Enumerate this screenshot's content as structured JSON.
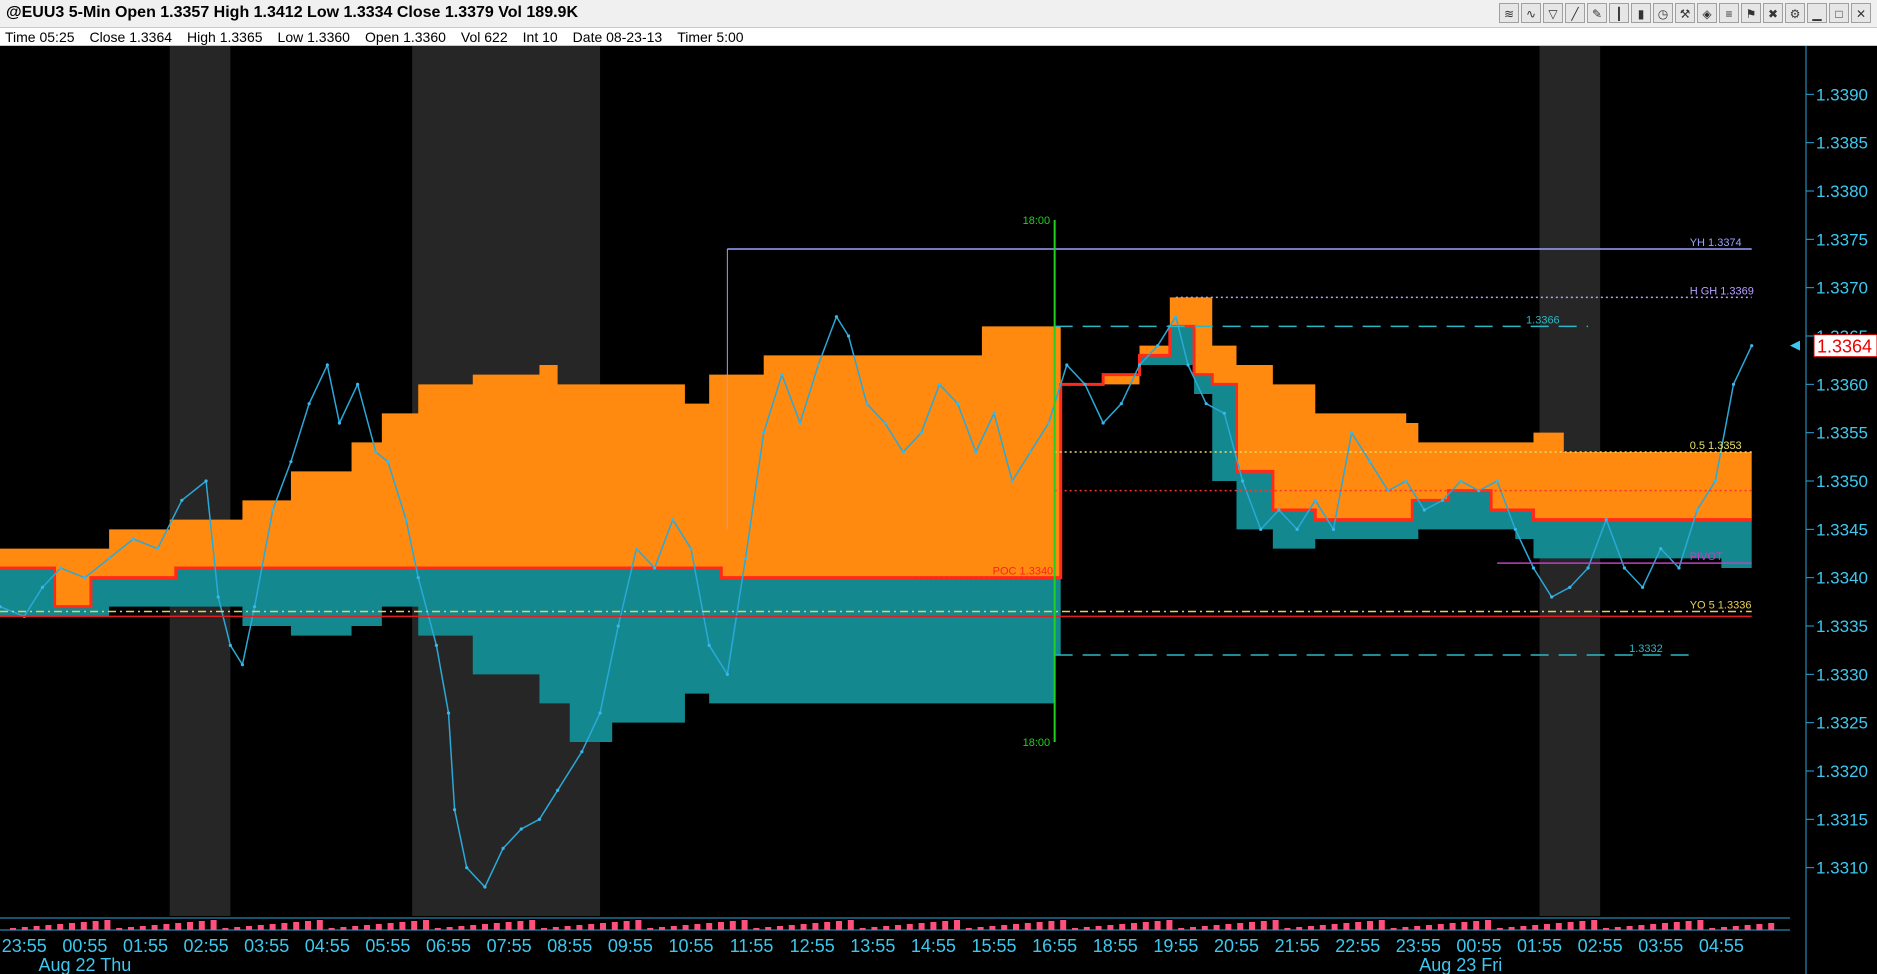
{
  "title": "@EUU3 5-Min Open 1.3357 High 1.3412 Low 1.3334 Close 1.3379 Vol 189.9K",
  "toolbar": {
    "buttons": [
      {
        "name": "chart-type-icon",
        "glyph": "≋"
      },
      {
        "name": "indicator-icon",
        "glyph": "∿"
      },
      {
        "name": "filter-icon",
        "glyph": "▽"
      },
      {
        "name": "draw-line-icon",
        "glyph": "╱"
      },
      {
        "name": "pencil-icon",
        "glyph": "✎"
      },
      {
        "name": "bar-style-icon",
        "glyph": "┃"
      },
      {
        "name": "candle-icon",
        "glyph": "▮"
      },
      {
        "name": "clock-icon",
        "glyph": "◷"
      },
      {
        "name": "tools-icon",
        "glyph": "⚒"
      },
      {
        "name": "alert-icon",
        "glyph": "◈"
      },
      {
        "name": "fib-icon",
        "glyph": "≡"
      },
      {
        "name": "flag-icon",
        "glyph": "⚑"
      },
      {
        "name": "trash-icon",
        "glyph": "✖"
      },
      {
        "name": "settings-icon",
        "glyph": "⚙"
      },
      {
        "name": "minimize-icon",
        "glyph": "▁"
      },
      {
        "name": "maximize-icon",
        "glyph": "□"
      },
      {
        "name": "close-icon",
        "glyph": "✕"
      }
    ]
  },
  "info": {
    "time": "Time 05:25",
    "close": "Close 1.3364",
    "high": "High 1.3365",
    "low": "Low 1.3360",
    "open": "Open 1.3360",
    "vol": "Vol 622",
    "int": "Int 10",
    "date": "Date 08-23-13",
    "timer": "Timer 5:00"
  },
  "chart_data": {
    "type": "line",
    "ylim": [
      1.3305,
      1.3395
    ],
    "y_ticks": [
      "1.3390",
      "1.3385",
      "1.3380",
      "1.3375",
      "1.3370",
      "1.3365",
      "1.3360",
      "1.3355",
      "1.3350",
      "1.3345",
      "1.3340",
      "1.3335",
      "1.3330",
      "1.3325",
      "1.3320",
      "1.3315",
      "1.3310"
    ],
    "x_ticks": [
      "23:55",
      "00:55",
      "01:55",
      "02:55",
      "03:55",
      "04:55",
      "05:55",
      "06:55",
      "07:55",
      "08:55",
      "09:55",
      "10:55",
      "11:55",
      "12:55",
      "13:55",
      "14:55",
      "15:55",
      "16:55",
      "18:55",
      "19:55",
      "20:55",
      "21:55",
      "22:55",
      "23:55",
      "00:55",
      "01:55",
      "02:55",
      "03:55",
      "04:55"
    ],
    "date_labels": [
      {
        "text": "Aug 22 Thu",
        "at": 1
      },
      {
        "text": "Aug 23 Fri",
        "at": 23.7
      }
    ],
    "shaded_sessions": [
      [
        2.4,
        3.4
      ],
      [
        6.4,
        9.5
      ],
      [
        25.0,
        26.0
      ]
    ],
    "x_range": [
      -0.4,
      29.0
    ],
    "value_area_top": [
      [
        -0.4,
        1.3343
      ],
      [
        1.4,
        1.3345
      ],
      [
        2.4,
        1.3346
      ],
      [
        3.6,
        1.3348
      ],
      [
        4.4,
        1.3351
      ],
      [
        5.4,
        1.3354
      ],
      [
        5.9,
        1.3357
      ],
      [
        6.5,
        1.336
      ],
      [
        7.4,
        1.3361
      ],
      [
        8.5,
        1.3362
      ],
      [
        8.8,
        1.336
      ],
      [
        10.9,
        1.3358
      ],
      [
        11.3,
        1.3361
      ],
      [
        12.2,
        1.3363
      ],
      [
        15.3,
        1.3363
      ],
      [
        15.8,
        1.3366
      ],
      [
        17.0,
        1.3366
      ],
      [
        17.1,
        1.336
      ],
      [
        17.8,
        1.336
      ],
      [
        18.4,
        1.3364
      ],
      [
        18.9,
        1.3369
      ],
      [
        19.3,
        1.3369
      ],
      [
        19.6,
        1.3364
      ],
      [
        20.0,
        1.3362
      ],
      [
        20.6,
        1.336
      ],
      [
        21.3,
        1.3357
      ],
      [
        22.8,
        1.3356
      ],
      [
        23.0,
        1.3354
      ],
      [
        24.6,
        1.3354
      ],
      [
        24.9,
        1.3355
      ],
      [
        25.4,
        1.3353
      ],
      [
        28.0,
        1.3353
      ],
      [
        28.5,
        1.3356
      ]
    ],
    "value_area_bottom": [
      [
        -0.4,
        1.3336
      ],
      [
        1.4,
        1.3337
      ],
      [
        2.4,
        1.3337
      ],
      [
        3.6,
        1.3335
      ],
      [
        4.4,
        1.3334
      ],
      [
        5.4,
        1.3335
      ],
      [
        5.9,
        1.3337
      ],
      [
        6.5,
        1.3334
      ],
      [
        7.4,
        1.333
      ],
      [
        8.5,
        1.3327
      ],
      [
        9.0,
        1.3323
      ],
      [
        9.7,
        1.3325
      ],
      [
        10.9,
        1.3328
      ],
      [
        11.3,
        1.3327
      ],
      [
        13.5,
        1.3327
      ],
      [
        15.3,
        1.3327
      ],
      [
        15.8,
        1.3327
      ],
      [
        17.0,
        1.3332
      ],
      [
        17.1,
        1.336
      ],
      [
        17.8,
        1.3361
      ],
      [
        18.4,
        1.3362
      ],
      [
        18.9,
        1.3362
      ],
      [
        19.3,
        1.3359
      ],
      [
        19.6,
        1.335
      ],
      [
        20.0,
        1.3345
      ],
      [
        20.6,
        1.3343
      ],
      [
        21.3,
        1.3344
      ],
      [
        22.8,
        1.3344
      ],
      [
        23.0,
        1.3345
      ],
      [
        24.6,
        1.3344
      ],
      [
        24.9,
        1.3342
      ],
      [
        25.4,
        1.3342
      ],
      [
        28.0,
        1.3341
      ],
      [
        28.5,
        1.3339
      ]
    ],
    "poc_line": [
      [
        -0.4,
        1.3341
      ],
      [
        0.3,
        1.3341
      ],
      [
        0.5,
        1.3337
      ],
      [
        1.0,
        1.3337
      ],
      [
        1.1,
        1.334
      ],
      [
        2.4,
        1.334
      ],
      [
        2.5,
        1.3341
      ],
      [
        11.3,
        1.3341
      ],
      [
        11.5,
        1.334
      ],
      [
        17.0,
        1.334
      ],
      [
        17.1,
        1.336
      ],
      [
        17.8,
        1.3361
      ],
      [
        18.4,
        1.3363
      ],
      [
        18.9,
        1.3366
      ],
      [
        19.3,
        1.3361
      ],
      [
        19.6,
        1.336
      ],
      [
        20.0,
        1.3351
      ],
      [
        20.6,
        1.3347
      ],
      [
        21.3,
        1.3346
      ],
      [
        22.8,
        1.3346
      ],
      [
        22.9,
        1.3348
      ],
      [
        23.5,
        1.3349
      ],
      [
        24.0,
        1.3349
      ],
      [
        24.2,
        1.3347
      ],
      [
        24.6,
        1.3347
      ],
      [
        24.9,
        1.3346
      ],
      [
        28.5,
        1.3346
      ]
    ],
    "price": [
      [
        -0.4,
        1.3337
      ],
      [
        0.0,
        1.3336
      ],
      [
        0.3,
        1.3339
      ],
      [
        0.6,
        1.3341
      ],
      [
        1.0,
        1.334
      ],
      [
        1.4,
        1.3342
      ],
      [
        1.8,
        1.3344
      ],
      [
        2.2,
        1.3343
      ],
      [
        2.6,
        1.3348
      ],
      [
        3.0,
        1.335
      ],
      [
        3.2,
        1.3338
      ],
      [
        3.4,
        1.3333
      ],
      [
        3.6,
        1.3331
      ],
      [
        3.8,
        1.3337
      ],
      [
        4.1,
        1.3347
      ],
      [
        4.4,
        1.3352
      ],
      [
        4.7,
        1.3358
      ],
      [
        5.0,
        1.3362
      ],
      [
        5.2,
        1.3356
      ],
      [
        5.5,
        1.336
      ],
      [
        5.8,
        1.3353
      ],
      [
        6.0,
        1.3352
      ],
      [
        6.3,
        1.3346
      ],
      [
        6.5,
        1.334
      ],
      [
        6.8,
        1.3333
      ],
      [
        7.0,
        1.3326
      ],
      [
        7.1,
        1.3316
      ],
      [
        7.3,
        1.331
      ],
      [
        7.6,
        1.3308
      ],
      [
        7.9,
        1.3312
      ],
      [
        8.2,
        1.3314
      ],
      [
        8.5,
        1.3315
      ],
      [
        8.8,
        1.3318
      ],
      [
        9.2,
        1.3322
      ],
      [
        9.5,
        1.3326
      ],
      [
        9.8,
        1.3335
      ],
      [
        10.1,
        1.3343
      ],
      [
        10.4,
        1.3341
      ],
      [
        10.7,
        1.3346
      ],
      [
        11.0,
        1.3343
      ],
      [
        11.3,
        1.3333
      ],
      [
        11.6,
        1.333
      ],
      [
        11.9,
        1.3342
      ],
      [
        12.2,
        1.3355
      ],
      [
        12.5,
        1.3361
      ],
      [
        12.8,
        1.3356
      ],
      [
        13.1,
        1.3362
      ],
      [
        13.4,
        1.3367
      ],
      [
        13.6,
        1.3365
      ],
      [
        13.9,
        1.3358
      ],
      [
        14.2,
        1.3356
      ],
      [
        14.5,
        1.3353
      ],
      [
        14.8,
        1.3355
      ],
      [
        15.1,
        1.336
      ],
      [
        15.4,
        1.3358
      ],
      [
        15.7,
        1.3353
      ],
      [
        16.0,
        1.3357
      ],
      [
        16.3,
        1.335
      ],
      [
        16.6,
        1.3353
      ],
      [
        16.9,
        1.3356
      ],
      [
        17.2,
        1.3362
      ],
      [
        17.5,
        1.336
      ],
      [
        17.8,
        1.3356
      ],
      [
        18.1,
        1.3358
      ],
      [
        18.4,
        1.3362
      ],
      [
        18.7,
        1.3364
      ],
      [
        19.0,
        1.3367
      ],
      [
        19.2,
        1.3362
      ],
      [
        19.5,
        1.3358
      ],
      [
        19.8,
        1.3357
      ],
      [
        20.1,
        1.335
      ],
      [
        20.4,
        1.3345
      ],
      [
        20.7,
        1.3347
      ],
      [
        21.0,
        1.3345
      ],
      [
        21.3,
        1.3348
      ],
      [
        21.6,
        1.3345
      ],
      [
        21.9,
        1.3355
      ],
      [
        22.2,
        1.3352
      ],
      [
        22.5,
        1.3349
      ],
      [
        22.8,
        1.335
      ],
      [
        23.1,
        1.3347
      ],
      [
        23.4,
        1.3348
      ],
      [
        23.7,
        1.335
      ],
      [
        24.0,
        1.3349
      ],
      [
        24.3,
        1.335
      ],
      [
        24.6,
        1.3345
      ],
      [
        24.9,
        1.3341
      ],
      [
        25.2,
        1.3338
      ],
      [
        25.5,
        1.3339
      ],
      [
        25.8,
        1.3341
      ],
      [
        26.1,
        1.3346
      ],
      [
        26.4,
        1.3341
      ],
      [
        26.7,
        1.3339
      ],
      [
        27.0,
        1.3343
      ],
      [
        27.3,
        1.3341
      ],
      [
        27.6,
        1.3347
      ],
      [
        27.9,
        1.335
      ],
      [
        28.2,
        1.336
      ],
      [
        28.5,
        1.3364
      ]
    ],
    "levels": [
      {
        "name": "yh",
        "label": "YH 1.3374",
        "y": 1.3374,
        "x0": 11.6,
        "x1": 28.5,
        "color": "#9aa2ff",
        "dash": "none"
      },
      {
        "name": "high",
        "label": "H GH 1.3369",
        "y": 1.3369,
        "x0": 19.0,
        "x1": 28.5,
        "color": "#b9a0ff",
        "dash": "2,3"
      },
      {
        "name": "upper-band",
        "label": "1.3366",
        "y": 1.3366,
        "x0": 17.0,
        "x1": 25.8,
        "color": "#2ab8c4",
        "dash": "18,10"
      },
      {
        "name": "mid",
        "label": "0.5 1.3353",
        "y": 1.3353,
        "x0": 17.0,
        "x1": 28.5,
        "color": "#e8e06a",
        "dash": "2,3"
      },
      {
        "name": "red-dotted",
        "label": "",
        "y": 1.3349,
        "x0": 17.0,
        "x1": 28.5,
        "color": "#ff3030",
        "dash": "2,3"
      },
      {
        "name": "pivot",
        "label": "PIVOT",
        "y": 1.33415,
        "x0": 24.3,
        "x1": 28.5,
        "color": "#c040c0",
        "dash": "none"
      },
      {
        "name": "poc",
        "label": "POC 1.3340",
        "y": 1.334,
        "x0": 14.7,
        "x1": 17.0,
        "color": "#ff2020",
        "dash": "2,3"
      },
      {
        "name": "yo5",
        "label": "YO 5 1.3336",
        "y": 1.33365,
        "x0": -0.4,
        "x1": 28.5,
        "color": "#e8d050",
        "dash": "8,4,2,4"
      },
      {
        "name": "close-ref",
        "label": "",
        "y": 1.3336,
        "x0": -0.4,
        "x1": 28.5,
        "color": "#e02020",
        "dash": "none"
      },
      {
        "name": "lower-band",
        "label": "1.3332",
        "y": 1.3332,
        "x0": 17.0,
        "x1": 27.5,
        "color": "#2ab8c4",
        "dash": "18,10"
      }
    ],
    "session_marker": {
      "label": "18:00",
      "at": 17.0
    },
    "last_price": {
      "label": "1.3364",
      "y": 1.3364
    }
  }
}
